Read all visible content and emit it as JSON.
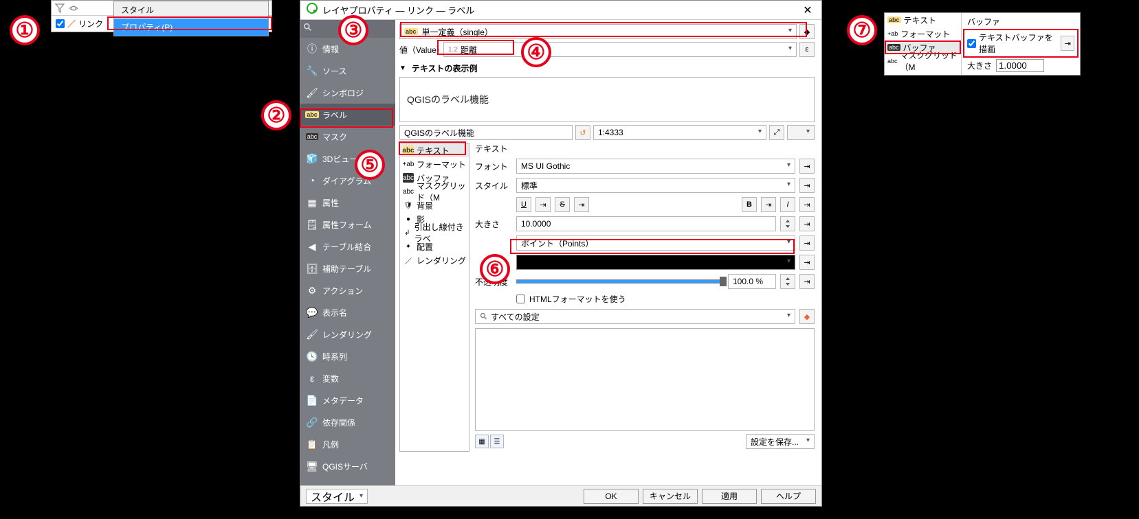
{
  "panel1": {
    "menu_style": "スタイル",
    "menu_properties": "プロパティ(P)...",
    "layer_name": "リンク"
  },
  "dialog": {
    "title": "レイヤプロパティ — リンク — ラベル",
    "sidebar": [
      "情報",
      "ソース",
      "シンボロジ",
      "ラベル",
      "マスク",
      "3Dビュー",
      "ダイアグラム",
      "属性",
      "属性フォーム",
      "テーブル結合",
      "補助テーブル",
      "アクション",
      "表示名",
      "レンダリング",
      "時系列",
      "変数",
      "メタデータ",
      "依存関係",
      "凡例",
      "QGISサーバ"
    ],
    "label_mode": "単一定義（single）",
    "value_label": "値（Value）",
    "value_field": "距離",
    "value_prefix": "1.2",
    "preview_heading": "テキストの表示例",
    "preview_text": "QGISのラベル機能",
    "sample_text": "QGISのラベル機能",
    "scale": "1:4333",
    "style_items": [
      "テキスト",
      "フォーマット",
      "バッファ",
      "マスクグリッド（M",
      "背景",
      "影",
      "引出し線付きラベ",
      "配置",
      "レンダリング"
    ],
    "text_heading": "テキスト",
    "font_label": "フォント",
    "font_value": "MS UI Gothic",
    "style_label": "スタイル",
    "style_value": "標準",
    "size_label": "大きさ",
    "size_value": "10.0000",
    "size_unit": "ポイント（Points）",
    "opacity_label": "不透明度",
    "opacity_value": "100.0 %",
    "html_checkbox": "HTMLフォーマットを使う",
    "all_settings": "すべての設定",
    "save_settings": "設定を保存...",
    "style_menu": "スタイル",
    "buttons": {
      "ok": "OK",
      "cancel": "キャンセル",
      "apply": "適用",
      "help": "ヘルプ"
    }
  },
  "panel7": {
    "left_items": [
      "テキスト",
      "フォーマット",
      "バッファ",
      "マスクグリッド（M"
    ],
    "header": "バッファ",
    "checkbox_label": "テキストバッファを描画",
    "size_label": "大きさ",
    "size_value": "1.0000"
  }
}
